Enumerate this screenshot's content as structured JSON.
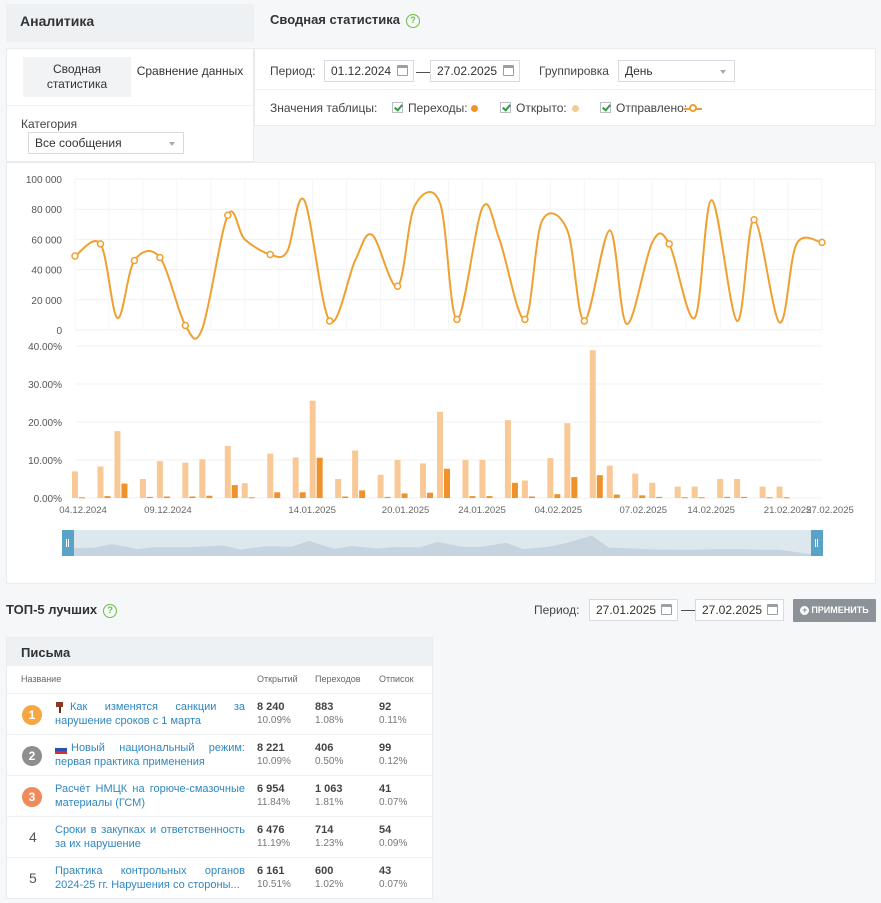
{
  "sidebar": {
    "title": "Аналитика",
    "tabs": [
      {
        "line1": "Сводная",
        "line2": "статистика",
        "active": true
      },
      {
        "label": "Сравнение данных",
        "active": false
      }
    ],
    "category_label": "Категория",
    "category_value": "Все сообщения"
  },
  "main": {
    "title": "Сводная статистика",
    "help_glyph": "?",
    "period_label": "Период:",
    "date_from": "01.12.2024",
    "date_sep": "—",
    "date_to": "27.02.2025",
    "grouping_label": "Группировка",
    "grouping_value": "День",
    "table_values_label": "Значения таблицы:",
    "legend": [
      {
        "label": "Переходы:",
        "color": "#f0922c",
        "marker": "dot"
      },
      {
        "label": "Открыто:",
        "color": "#f8c997",
        "marker": "dot"
      },
      {
        "label": "Отправлено:",
        "color": "#f0a030",
        "marker": "line-circle"
      }
    ]
  },
  "chart_data": [
    {
      "type": "line",
      "series": [
        {
          "name": "Отправлено",
          "color": "#f0a030",
          "x": [
            0,
            3,
            5,
            7,
            10,
            13,
            15,
            18,
            20,
            23,
            25,
            27,
            30,
            33,
            35,
            38,
            40,
            43,
            45,
            48,
            50,
            53,
            55,
            58,
            60,
            63,
            65,
            68,
            70,
            73,
            75,
            78,
            80,
            83,
            85,
            88
          ],
          "values": [
            49000,
            57000,
            8000,
            46000,
            48000,
            3000,
            1000,
            76000,
            60000,
            50000,
            52000,
            86000,
            6000,
            46000,
            63000,
            29000,
            82000,
            84000,
            7000,
            81000,
            60000,
            7000,
            72000,
            66000,
            6000,
            66000,
            4000,
            58000,
            57000,
            8000,
            86000,
            6000,
            73000,
            5000,
            57000,
            58000
          ]
        }
      ],
      "ylim": [
        0,
        100000
      ],
      "yticks": [
        "100 000",
        "80 000",
        "60 000",
        "40 000",
        "20 000",
        "0"
      ],
      "grid": true
    },
    {
      "type": "bar",
      "series": [
        {
          "name": "Открыто",
          "color": "#f8c997",
          "x": [
            0,
            3,
            5,
            8,
            10,
            13,
            15,
            18,
            20,
            23,
            26,
            28,
            31,
            33,
            36,
            38,
            41,
            43,
            46,
            48,
            51,
            53,
            56,
            58,
            61,
            63,
            66,
            68,
            71,
            73,
            76,
            78,
            81,
            83
          ],
          "values": [
            7.0,
            8.3,
            17.6,
            5.0,
            9.7,
            9.3,
            10.2,
            13.7,
            3.9,
            11.7,
            10.7,
            25.6,
            5.0,
            12.5,
            6.1,
            10.0,
            9.1,
            22.7,
            10.0,
            10.0,
            20.5,
            4.6,
            10.5,
            19.7,
            38.9,
            8.5,
            6.4,
            4.0,
            3.0,
            3.0,
            5.0,
            5.0,
            3.0,
            3.0
          ]
        },
        {
          "name": "Переходы",
          "color": "#f0922c",
          "x": [
            0,
            3,
            5,
            8,
            10,
            13,
            15,
            18,
            20,
            23,
            26,
            28,
            31,
            33,
            36,
            38,
            41,
            43,
            46,
            48,
            51,
            53,
            56,
            58,
            61,
            63,
            66,
            68,
            71,
            73,
            76,
            78,
            81,
            83
          ],
          "values": [
            0.2,
            0.5,
            3.8,
            0.3,
            0.4,
            0.4,
            0.6,
            3.4,
            0.2,
            1.5,
            1.5,
            10.6,
            0.4,
            2.0,
            0.3,
            1.2,
            1.4,
            7.7,
            0.5,
            0.5,
            4.0,
            0.4,
            1.0,
            5.5,
            6.0,
            0.9,
            0.7,
            0.3,
            0.2,
            0.2,
            0.3,
            0.3,
            0.2,
            0.2
          ]
        }
      ],
      "ylim": [
        0,
        40
      ],
      "yticks": [
        "40.00%",
        "30.00%",
        "20.00%",
        "10.00%",
        "0.00%"
      ],
      "xtick_labels": [
        "04.12.2024",
        "09.12.2024",
        "14.01.2025",
        "20.01.2025",
        "24.01.2025",
        "04.02.2025",
        "07.02.2025",
        "14.02.2025",
        "21.02.2025",
        "27.02.2025"
      ],
      "grid": true
    }
  ],
  "top5": {
    "title": "ТОП-5 лучших",
    "period_label": "Период:",
    "date_from": "27.01.2025",
    "date_sep": "—",
    "date_to": "27.02.2025",
    "apply_label": "ПРИМЕНИТЬ",
    "table": {
      "title": "Письма",
      "headers": [
        "Название",
        "Открытий",
        "Переходов",
        "Отписок"
      ],
      "rows": [
        {
          "rank": "1",
          "medal": "#f5a742",
          "flag": "hammer",
          "title": "Как изменятся санкции за нарушение сроков с 1 марта",
          "opens": "8 240",
          "opens_pct": "10.09%",
          "clicks": "883",
          "clicks_pct": "1.08%",
          "unsub": "92",
          "unsub_pct": "0.11%"
        },
        {
          "rank": "2",
          "medal": "#8e8e8e",
          "flag": "ru",
          "title": "Новый национальный режим: первая практика применения",
          "opens": "8 221",
          "opens_pct": "10.09%",
          "clicks": "406",
          "clicks_pct": "0.50%",
          "unsub": "99",
          "unsub_pct": "0.12%"
        },
        {
          "rank": "3",
          "medal": "#ef8a5b",
          "flag": "",
          "title": "Расчёт НМЦК на горюче-смазочные материалы (ГСМ)",
          "opens": "6 954",
          "opens_pct": "11.84%",
          "clicks": "1 063",
          "clicks_pct": "1.81%",
          "unsub": "41",
          "unsub_pct": "0.07%"
        },
        {
          "rank": "4",
          "medal": "",
          "flag": "",
          "title": "Сроки в закупках и ответственность за их нарушение",
          "opens": "6 476",
          "opens_pct": "11.19%",
          "clicks": "714",
          "clicks_pct": "1.23%",
          "unsub": "54",
          "unsub_pct": "0.09%"
        },
        {
          "rank": "5",
          "medal": "",
          "flag": "",
          "title": "Практика контрольных органов 2024-25 гг. Нарушения со стороны...",
          "opens": "6 161",
          "opens_pct": "10.51%",
          "clicks": "600",
          "clicks_pct": "1.02%",
          "unsub": "43",
          "unsub_pct": "0.07%"
        }
      ]
    }
  }
}
